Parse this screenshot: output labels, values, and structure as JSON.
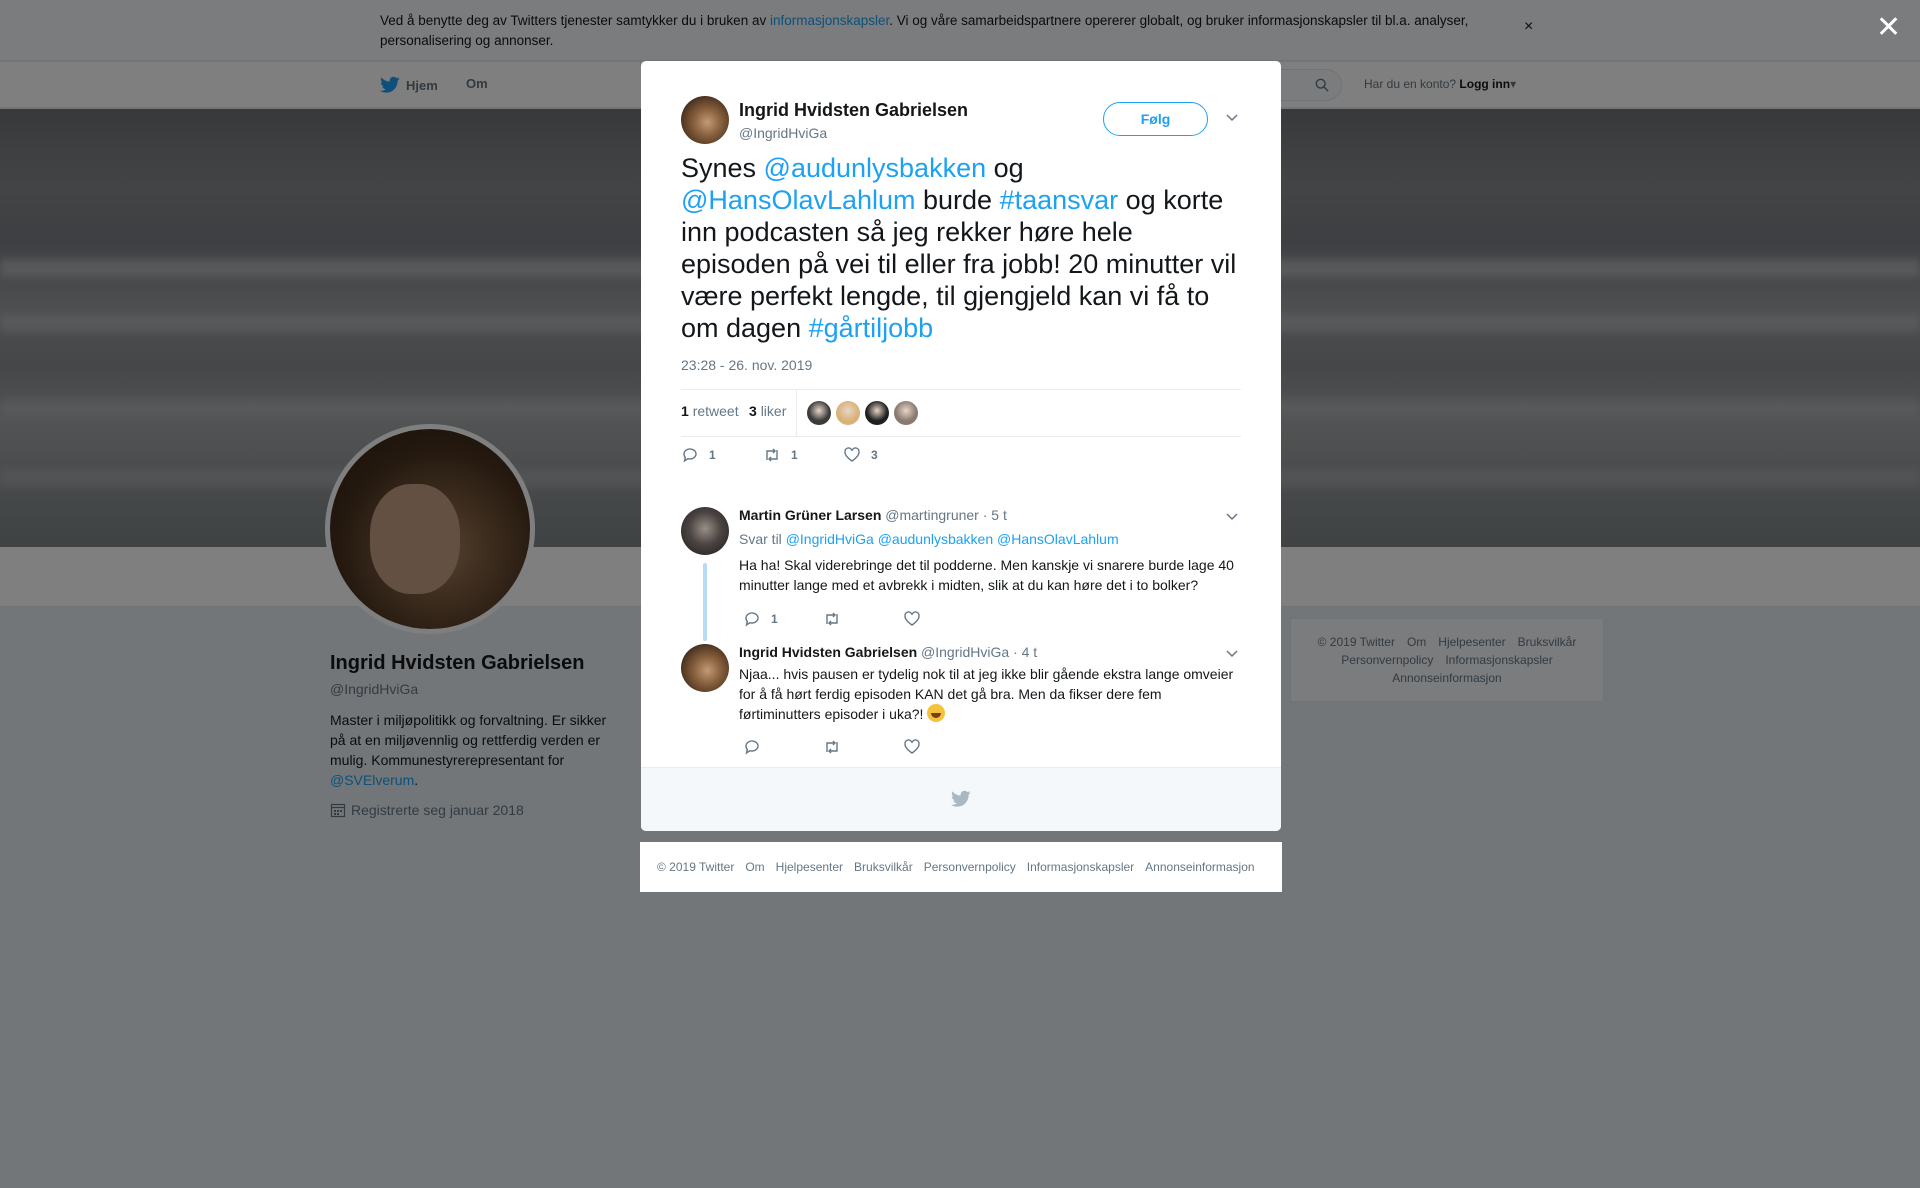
{
  "cookie": {
    "text_before": "Ved å benytte deg av Twitters tjenester samtykker du i bruken av ",
    "link": "informasjonskapsler",
    "text_after": ". Vi og våre samarbeidspartnere opererer globalt, og bruker informasjonskapsler til bl.a. analyser, personalisering og annonser.",
    "close": "×"
  },
  "nav": {
    "home": "Hjem",
    "about": "Om",
    "login_prompt": "Har du en konto?",
    "login": "Logg inn"
  },
  "overlay_close": "✕",
  "profile": {
    "name": "Ingrid Hvidsten Gabrielsen",
    "handle": "@IngridHviGa",
    "bio": "Master i miljøpolitikk og forvaltning. Er sikker på at en miljøvennlig og rettferdig verden er mulig. Kommunestyrerepresentant for ",
    "bio_link": "@SVElverum",
    "bio_end": ".",
    "joined": "Registrerte seg januar 2018"
  },
  "side_footer": [
    "© 2019 Twitter",
    "Om",
    "Hjelpesenter",
    "Bruksvilkår",
    "Personvernpolicy",
    "Informasjonskapsler",
    "Annonseinformasjon"
  ],
  "tweet": {
    "author_name": "Ingrid Hvidsten Gabrielsen",
    "author_handle": "@IngridHviGa",
    "follow": "Følg",
    "parts": [
      {
        "t": "Synes ",
        "link": false
      },
      {
        "t": "@audunlysbakken",
        "link": true
      },
      {
        "t": " og ",
        "link": false
      },
      {
        "t": "@HansOlavLahlum",
        "link": true
      },
      {
        "t": " burde ",
        "link": false
      },
      {
        "t": "#taansvar",
        "link": true
      },
      {
        "t": " og korte inn podcasten så jeg rekker høre hele episoden på vei til eller fra jobb! 20 minutter vil være perfekt lengde, til gjengjeld kan vi få to om dagen ",
        "link": false
      },
      {
        "t": "#gårtiljobb",
        "link": true
      }
    ],
    "time": "23:28 - 26. nov. 2019",
    "retweets_count": "1",
    "retweets_label": "retweet",
    "likes_count": "3",
    "likes_label": "liker",
    "liker_colors": [
      "#3b3b3b",
      "#d9b27a",
      "#1f1f1f",
      "#8a7a70"
    ],
    "actions": {
      "replies": "1",
      "retweets": "1",
      "likes": "3"
    }
  },
  "replies": [
    {
      "name": "Martin Grüner Larsen",
      "handle": "@martingruner",
      "time": "· 5 t",
      "reply_to_label": "Svar til",
      "reply_to": [
        "@IngridHviGa",
        "@audunlysbakken",
        "@HansOlavLahlum"
      ],
      "text": "Ha ha! Skal viderebringe det til podderne. Men kanskje vi snarere burde lage 40 minutter lange med et avbrekk i midten, slik at du kan høre det i to bolker?",
      "reply_count": "1"
    },
    {
      "name": "Ingrid Hvidsten Gabrielsen",
      "handle": "@IngridHviGa",
      "time": "· 4 t",
      "text": "Njaa... hvis pausen er tydelig nok til at jeg ikke blir gående ekstra lange omveier for å få hørt ferdig episoden KAN det gå bra. Men da fikser dere fem førtiminutters episoder i uka?!"
    }
  ],
  "bottom_links": [
    "© 2019 Twitter",
    "Om",
    "Hjelpesenter",
    "Bruksvilkår",
    "Personvernpolicy",
    "Informasjonskapsler",
    "Annonseinformasjon"
  ],
  "colors": {
    "accent": "#1da1f2",
    "text": "#14171a",
    "muted": "#657786"
  }
}
